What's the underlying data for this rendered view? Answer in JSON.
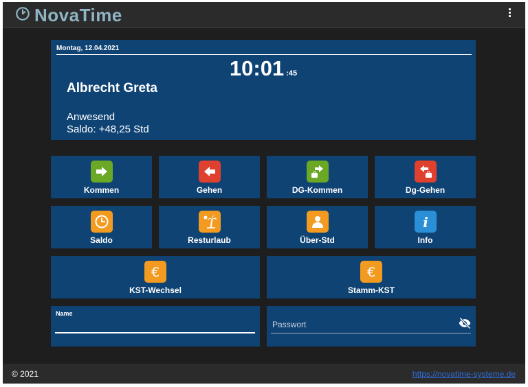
{
  "header": {
    "brand": "NovaTime",
    "logo_icon": "clock-logo-icon",
    "menu_icon": "kebab-menu-icon"
  },
  "info_panel": {
    "date": "Montag, 12.04.2021",
    "time": "10:01",
    "seconds": ":45",
    "person": "Albrecht Greta",
    "status": "Anwesend",
    "saldo": "Saldo: +48,25 Std"
  },
  "actions": [
    {
      "label": "Kommen",
      "icon": "arrow-right-icon",
      "color": "#6aa826"
    },
    {
      "label": "Gehen",
      "icon": "arrow-left-icon",
      "color": "#e0412f"
    },
    {
      "label": "DG-Kommen",
      "icon": "briefcase-arrow-right-icon",
      "color": "#6aa826"
    },
    {
      "label": "Dg-Gehen",
      "icon": "briefcase-arrow-left-icon",
      "color": "#e0412f"
    },
    {
      "label": "Saldo",
      "icon": "clock-icon",
      "color": "#f29b20"
    },
    {
      "label": "Resturlaub",
      "icon": "palm-tree-icon",
      "color": "#f29b20"
    },
    {
      "label": "Über-Std",
      "icon": "person-icon",
      "color": "#f29b20"
    },
    {
      "label": "Info",
      "icon": "info-icon",
      "color": "#2b8fd8"
    },
    {
      "label": "KST-Wechsel",
      "icon": "euro-icon",
      "color": "#f29b20"
    },
    {
      "label": "Stamm-KST",
      "icon": "euro-icon",
      "color": "#f29b20"
    }
  ],
  "login": {
    "name_label": "Name",
    "name_value": "",
    "password_placeholder": "Passwort",
    "password_value": "",
    "eye_icon": "eye-slash-icon"
  },
  "footer": {
    "copyright": "© 2021",
    "link": "https://novatime-systeme.de"
  }
}
